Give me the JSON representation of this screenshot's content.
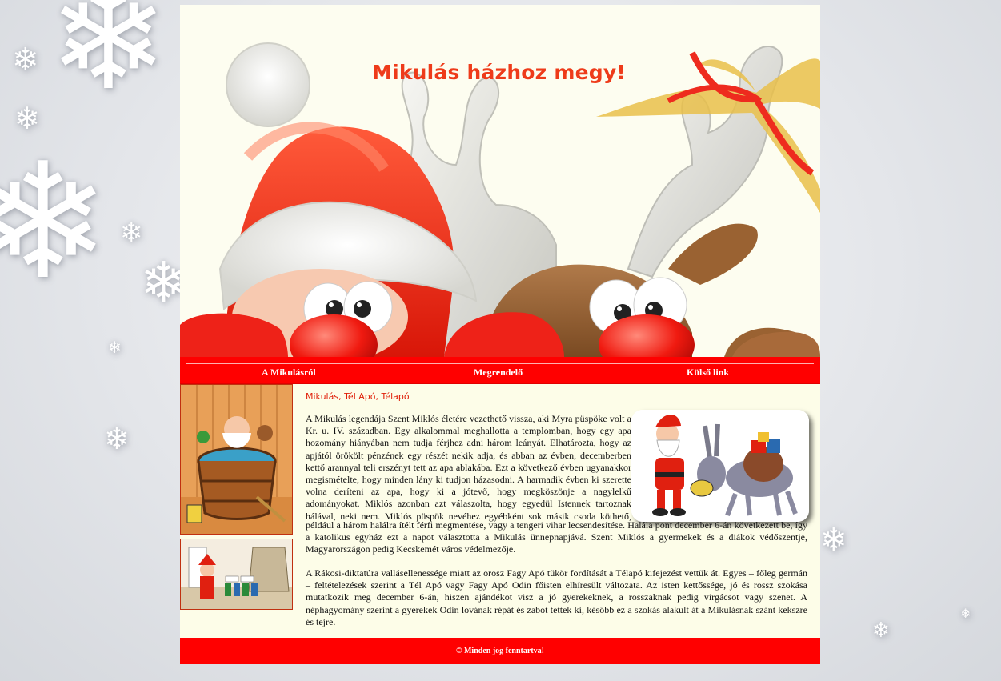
{
  "header": {
    "title": "Mikulás házhoz megy!"
  },
  "nav": {
    "items": [
      {
        "label": "A Mikulásról"
      },
      {
        "label": "Megrendelő"
      },
      {
        "label": "Külső link"
      }
    ]
  },
  "main": {
    "heading": "Mikulás, Tél Apó, Télapó",
    "paragraph1": "A Mikulás legendája Szent Miklós életére vezethető vissza, aki Myra püspöke volt a Kr. u. IV. században. Egy alkalommal meghallotta a templomban, hogy egy apa hozomány hiányában nem tudja férjhez adni három leányát. Elhatározta, hogy az apjától örökölt pénzének egy részét nekik adja, és abban az évben, decemberben kettő arannyal teli erszényt tett az apa ablakába. Ezt a következő évben ugyanakkor megismételte, hogy minden lány ki tudjon házasodni. A harmadik évben ki szerette volna deríteni az apa, hogy ki a jótevő, hogy megköszönje a nagylelkű adományokat. Miklós azonban azt válaszolta, hogy egyedül Istennek tartoznak hálával, neki nem. Miklós püspök nevéhez egyébként sok másik csoda köthető, például a három halálra ítélt férfi megmentése, vagy a tengeri vihar lecsendesítése. Halála pont december 6-án következett be, így a katolikus egyház ezt a napot választotta a Mikulás ünnepnapjává. Szent Miklós a gyermekek és a diákok védőszentje, Magyarországon pedig Kecskemét város védelmezője.",
    "paragraph2": "A Rákosi-diktatúra vallásellenessége miatt az orosz Fagy Apó tükör fordítását a Télapó kifejezést vettük át. Egyes – főleg germán – feltételezések szerint a Tél Apó vagy Fagy Apó Odin főisten elhíresült változata. Az isten kettőssége, jó és rossz szokása mutatkozik meg december 6-án, hiszen ajándékot visz a jó gyerekeknek, a rosszaknak pedig virgácsot vagy szenet. A néphagyomány szerint a gyerekek Odin lovának répát és zabot tettek ki, később ez a szokás alakult át a Mikulásnak szánt kekszre és tejre."
  },
  "footer": {
    "text": "© Minden jog fenntartva!"
  },
  "colors": {
    "accent": "#ff0000",
    "page_bg": "#fdfde8",
    "title": "#ee3b1a"
  }
}
